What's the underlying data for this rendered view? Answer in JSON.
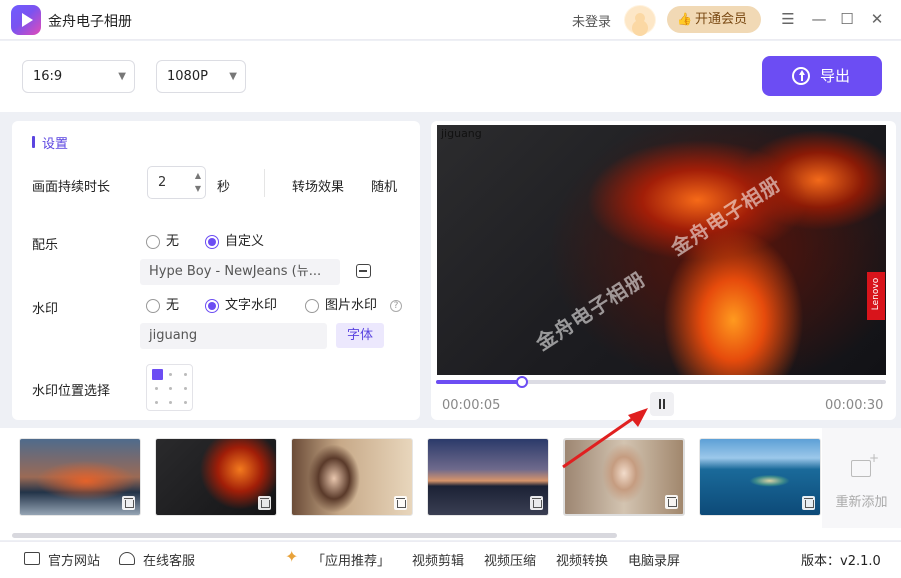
{
  "app": {
    "title": "金舟电子相册"
  },
  "titlebar": {
    "login_status": "未登录",
    "vip_label": "开通会员"
  },
  "toolbar": {
    "aspect_ratio": "16:9",
    "resolution": "1080P",
    "export_label": "导出"
  },
  "settings": {
    "title": "设置",
    "duration_label": "画面持续时长",
    "duration_value": "2",
    "duration_unit": "秒",
    "transition_label": "转场效果",
    "transition_value": "随机",
    "music_label": "配乐",
    "music_options": [
      "无",
      "自定义"
    ],
    "music_selected": "自定义",
    "music_file": "Hype Boy - NewJeans (뉴...",
    "watermark_label": "水印",
    "watermark_options": [
      "无",
      "文字水印",
      "图片水印"
    ],
    "watermark_selected": "文字水印",
    "watermark_text": "jiguang",
    "font_button": "字体",
    "position_label": "水印位置选择"
  },
  "preview": {
    "watermark_text": "jiguang",
    "overlay_watermark": "金舟电子相册",
    "brand_badge": "Lenovo",
    "current_time": "00:00:05",
    "total_time": "00:00:30",
    "progress": 0.19
  },
  "thumbnails": [
    {
      "name": "thumb-1"
    },
    {
      "name": "thumb-2"
    },
    {
      "name": "thumb-3"
    },
    {
      "name": "thumb-4"
    },
    {
      "name": "thumb-5"
    },
    {
      "name": "thumb-6"
    }
  ],
  "strip": {
    "readd_label": "重新添加"
  },
  "footer": {
    "official_site": "官方网站",
    "online_service": "在线客服",
    "recommend": "「应用推荐」",
    "links": [
      "视频剪辑",
      "视频压缩",
      "视频转换",
      "电脑录屏"
    ],
    "version": "版本：v2.1.0"
  },
  "colors": {
    "accent": "#6c4df3",
    "vip": "#f1d9b5"
  }
}
